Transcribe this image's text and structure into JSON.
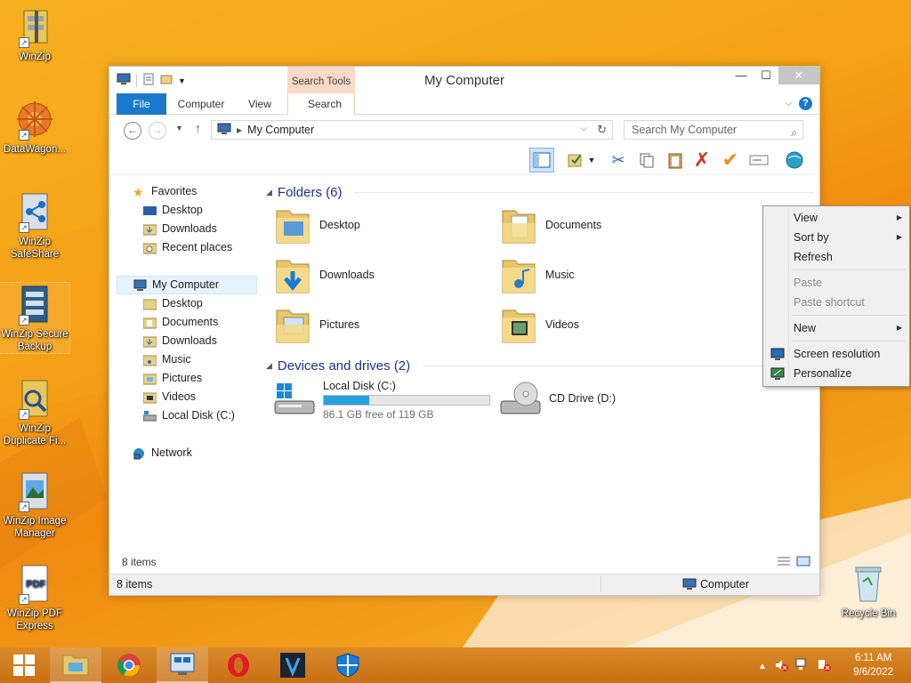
{
  "desktop": {
    "icons": [
      {
        "label": "WinZip"
      },
      {
        "label": "DataWagon..."
      },
      {
        "label": "WinZip SafeShare"
      },
      {
        "label": "WinZip Secure Backup"
      },
      {
        "label": "WinZip Duplicate Fi..."
      },
      {
        "label": "WinZip Image Manager"
      },
      {
        "label": "WinZip PDF Express"
      }
    ],
    "recycle_bin": "Recycle Bin"
  },
  "window": {
    "title": "My Computer",
    "context_tab_header": "Search Tools",
    "ribbon_tabs": [
      "File",
      "Computer",
      "View",
      "Search"
    ],
    "address": "My Computer",
    "search_placeholder": "Search My Computer",
    "nav": {
      "favorites": "Favorites",
      "fav_items": [
        "Desktop",
        "Downloads",
        "Recent places"
      ],
      "computer": "My Computer",
      "computer_items": [
        "Desktop",
        "Documents",
        "Downloads",
        "Music",
        "Pictures",
        "Videos",
        "Local Disk (C:)"
      ],
      "network": "Network"
    },
    "folders_header": "Folders (6)",
    "folders": [
      "Desktop",
      "Documents",
      "Downloads",
      "Music",
      "Pictures",
      "Videos"
    ],
    "devices_header": "Devices and drives (2)",
    "drives": {
      "c_label": "Local Disk (C:)",
      "c_free": "86.1 GB free of 119 GB",
      "c_used_fraction": 0.276,
      "d_label": "CD Drive (D:)"
    },
    "item_count_inner": "8 items",
    "status_count": "8 items",
    "status_location": "Computer"
  },
  "context_menu": {
    "items": [
      "View",
      "Sort by",
      "Refresh",
      "Paste",
      "Paste shortcut",
      "New",
      "Screen resolution",
      "Personalize"
    ]
  },
  "taskbar": {
    "time": "6:11 AM",
    "date": "9/6/2022"
  }
}
